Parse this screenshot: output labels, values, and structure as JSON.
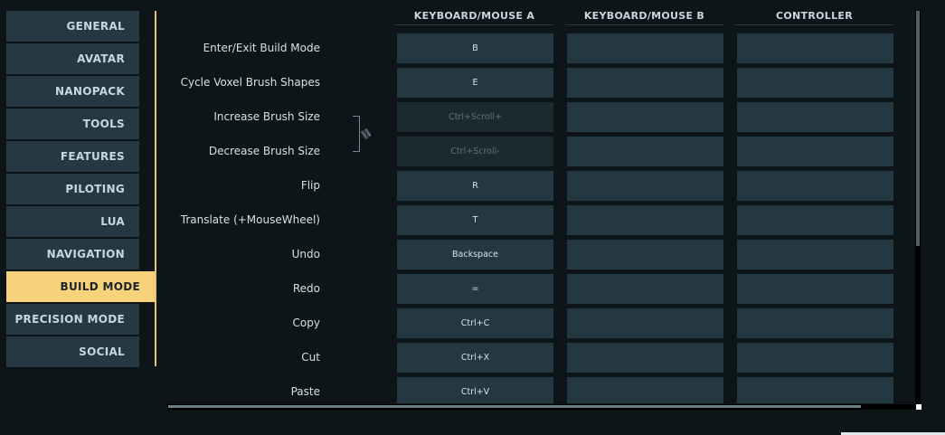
{
  "sidebar": {
    "items": [
      {
        "label": "GENERAL"
      },
      {
        "label": "AVATAR"
      },
      {
        "label": "NANOPACK"
      },
      {
        "label": "TOOLS"
      },
      {
        "label": "FEATURES"
      },
      {
        "label": "PILOTING"
      },
      {
        "label": "LUA"
      },
      {
        "label": "NAVIGATION"
      },
      {
        "label": "BUILD MODE"
      },
      {
        "label": "PRECISION MODE"
      },
      {
        "label": "SOCIAL"
      }
    ],
    "active": "BUILD MODE",
    "accent_color": "#f8d27a"
  },
  "columns": [
    "KEYBOARD/MOUSE A",
    "KEYBOARD/MOUSE B",
    "CONTROLLER"
  ],
  "bindings": [
    {
      "action": "Enter/Exit Build Mode",
      "a": "B",
      "b": "",
      "c": ""
    },
    {
      "action": "Cycle Voxel Brush Shapes",
      "a": "E",
      "b": "",
      "c": ""
    },
    {
      "action": "Increase Brush Size",
      "a": "Ctrl+Scroll+",
      "b": "",
      "c": ""
    },
    {
      "action": "Decrease Brush Size",
      "a": "Ctrl+Scroll-",
      "b": "",
      "c": ""
    },
    {
      "action": "Flip",
      "a": "R",
      "b": "",
      "c": ""
    },
    {
      "action": "Translate (+MouseWheel)",
      "a": "T",
      "b": "",
      "c": ""
    },
    {
      "action": "Undo",
      "a": "Backspace",
      "b": "",
      "c": ""
    },
    {
      "action": "Redo",
      "a": "=",
      "b": "",
      "c": ""
    },
    {
      "action": "Copy",
      "a": "Ctrl+C",
      "b": "",
      "c": ""
    },
    {
      "action": "Cut",
      "a": "Ctrl+X",
      "b": "",
      "c": ""
    },
    {
      "action": "Paste",
      "a": "Ctrl+V",
      "b": "",
      "c": ""
    }
  ],
  "icons": {
    "linked": "link-icon"
  }
}
